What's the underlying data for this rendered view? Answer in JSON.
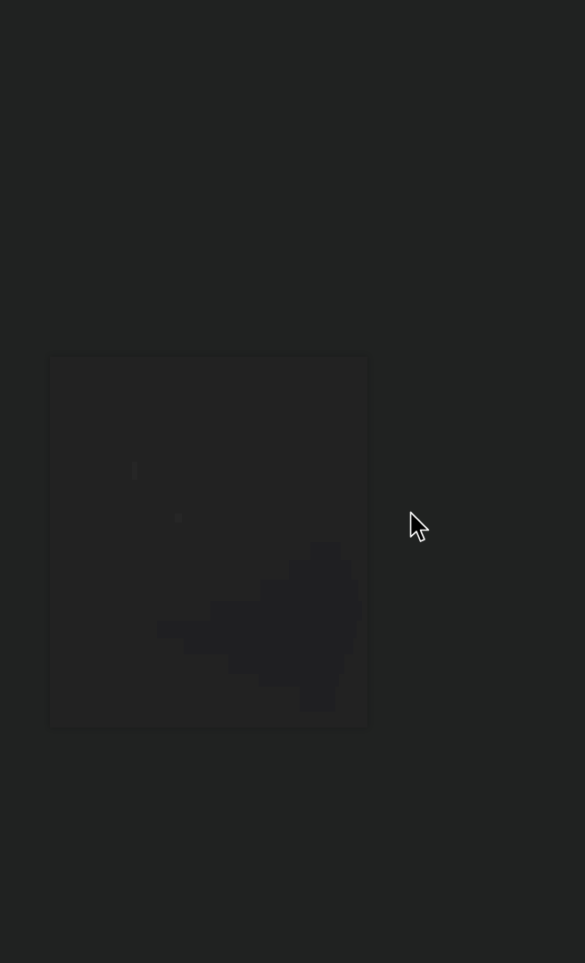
{
  "screen": {
    "background_color": "#202221"
  },
  "loading_panel": {
    "panel_color": "#222222",
    "art_color": "#1f1f21"
  },
  "cursor": {
    "icon": "arrow-cursor-icon",
    "fill_color": "#000000",
    "stroke_color": "#ffffff"
  }
}
